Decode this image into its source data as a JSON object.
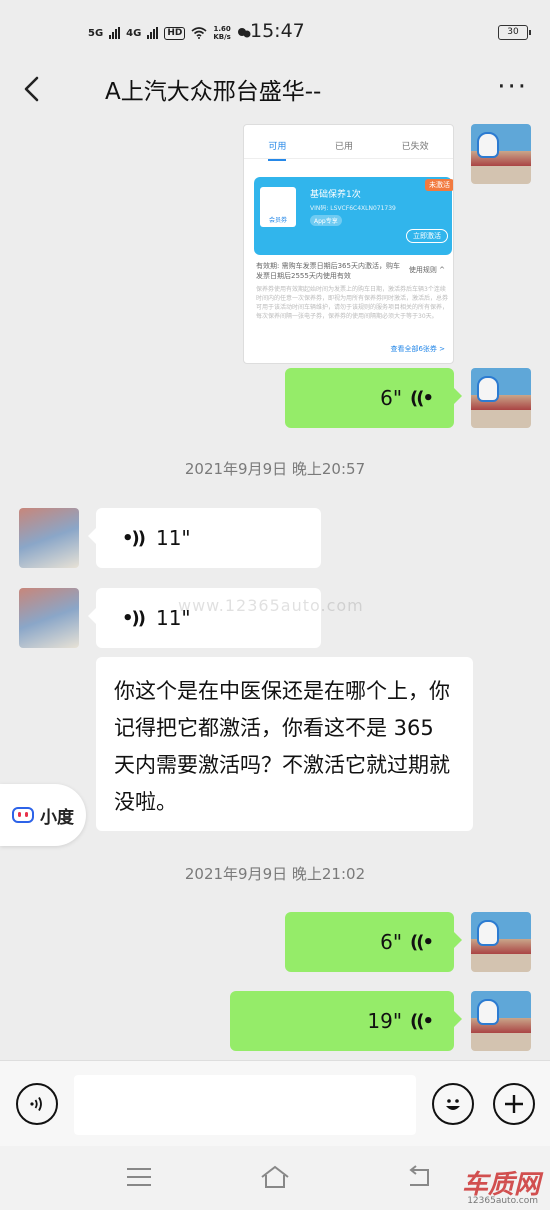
{
  "status_bar": {
    "network_1": "5G",
    "network_2": "4G",
    "hd": "HD",
    "speed_value": "1.60",
    "speed_unit": "KB/s",
    "time": "15:47",
    "battery": "30"
  },
  "header": {
    "title": "A上汽大众邢台盛华--",
    "more_label": "···"
  },
  "shared_card": {
    "tab_available": "可用",
    "tab_used": "已用",
    "tab_expired": "已失效",
    "coupon_icon_label": "会员券",
    "coupon_title": "基础保养1次",
    "coupon_vin": "VIN码: LSVCF6C4XLN071739",
    "coupon_tag": "App专享",
    "coupon_badge": "未激活",
    "coupon_button": "立即激活",
    "validity": "有效期: 需购车发票日期后365天内激活，购车发票日期后2555天内使用有效",
    "rules": "使用规则 ^",
    "description": "保养券使用有效期起始时间为发票上的购车日期，激活券后车辆3个连续时间内的任意一次保养券，即视为用所有保养券同时激活，激活后，总券可用于该活动时间车辆维护，请勿于该规则的服务项目相关的所有保养，每次保养间隔一张电子券，保养券的使用间隔期必须大于等于30天。",
    "more_link": "查看全部6张券 >"
  },
  "messages": {
    "voice_me_1": "6\"",
    "timestamp_1": "2021年9月9日 晚上20:57",
    "voice_other_1": "11\"",
    "voice_other_2": "11\"",
    "text_other": "你这个是在中医保还是在哪个上，你记得把它都激活，你看这不是 365 天内需要激活吗？不激活它就过期就没啦。",
    "timestamp_2": "2021年9月9日 晚上21:02",
    "voice_me_2": "6\"",
    "voice_me_3": "19\""
  },
  "icons": {
    "voice_out": "((•",
    "voice_in": "•))"
  },
  "watermark": "www.12365auto.com",
  "xiaodu_label": "小度",
  "input_bar": {
    "voice_icon": "voice-icon",
    "emoji_icon": "emoji-icon",
    "plus_icon": "plus-icon"
  },
  "bottom_logo": "车质网",
  "bottom_logo_sub": "12365auto.com",
  "colors": {
    "my_bubble": "#95ec69",
    "other_bubble": "#ffffff",
    "background": "#ededed",
    "link_blue": "#2688e8"
  }
}
